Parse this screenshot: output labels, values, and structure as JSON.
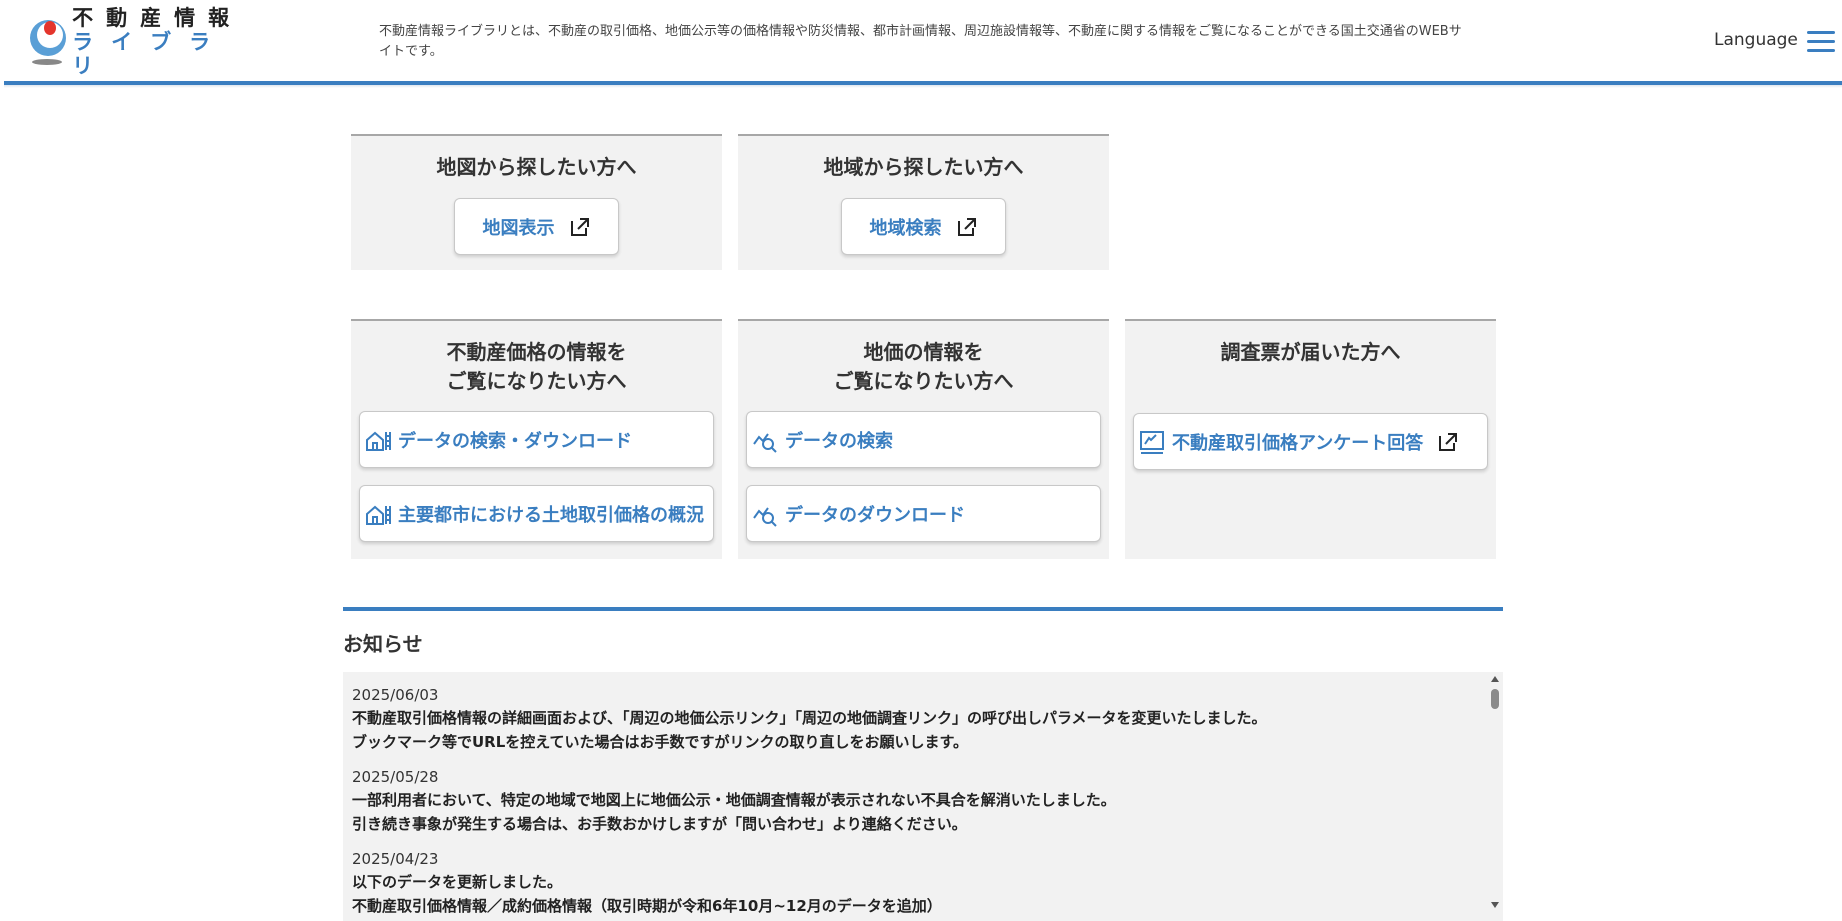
{
  "header": {
    "logo_top": "不動産情報",
    "logo_bottom": "ライブラリ",
    "description": "不動産情報ライブラリとは、不動産の取引価格、地価公示等の価格情報や防災情報、都市計画情報、周辺施設情報等、不動産に関する情報をご覧になることができる国土交通省のWEBサイトです。",
    "language_label": "Language",
    "menu_icon": "hamburger-menu-icon"
  },
  "search_cards": {
    "map": {
      "title": "地図から探したい方へ",
      "button_label": "地図表示",
      "icon": "external-link-icon"
    },
    "area": {
      "title": "地域から探したい方へ",
      "button_label": "地域検索",
      "icon": "external-link-icon"
    }
  },
  "info_cards": {
    "price": {
      "title_line1": "不動産価格の情報を",
      "title_line2": "ご覧になりたい方へ",
      "buttons": [
        {
          "label": "データの検索・ダウンロード",
          "icon": "building-chart-icon"
        },
        {
          "label": "主要都市における土地取引価格の概況",
          "icon": "building-chart-icon"
        }
      ]
    },
    "land": {
      "title_line1": "地価の情報を",
      "title_line2": "ご覧になりたい方へ",
      "buttons": [
        {
          "label": "データの検索",
          "icon": "chart-search-icon"
        },
        {
          "label": "データのダウンロード",
          "icon": "chart-search-icon"
        }
      ]
    },
    "survey": {
      "title": "調査票が届いた方へ",
      "button_label": "不動産取引価格アンケート回答",
      "icon": "survey-form-icon"
    }
  },
  "news": {
    "title": "お知らせ",
    "items": [
      {
        "date": "2025/06/03",
        "lines": [
          "不動産取引価格情報の詳細画面および、「周辺の地価公示リンク」「周辺の地価調査リンク」の呼び出しパラメータを変更いたしました。",
          "ブックマーク等でURLを控えていた場合はお手数ですがリンクの取り直しをお願いします。"
        ]
      },
      {
        "date": "2025/05/28",
        "lines": [
          "一部利用者において、特定の地域で地図上に地価公示・地価調査情報が表示されない不具合を解消いたしました。",
          "引き続き事象が発生する場合は、お手数おかけしますが「問い合わせ」より連絡ください。"
        ]
      },
      {
        "date": "2025/04/23",
        "lines": [
          "以下のデータを更新しました。",
          "不動産取引価格情報／成約価格情報（取引時期が令和6年10月~12月のデータを追加）"
        ]
      }
    ]
  },
  "colors": {
    "accent": "#3a7ec0",
    "card_bg": "#f2f2f2",
    "logo_red": "#e4352c"
  }
}
